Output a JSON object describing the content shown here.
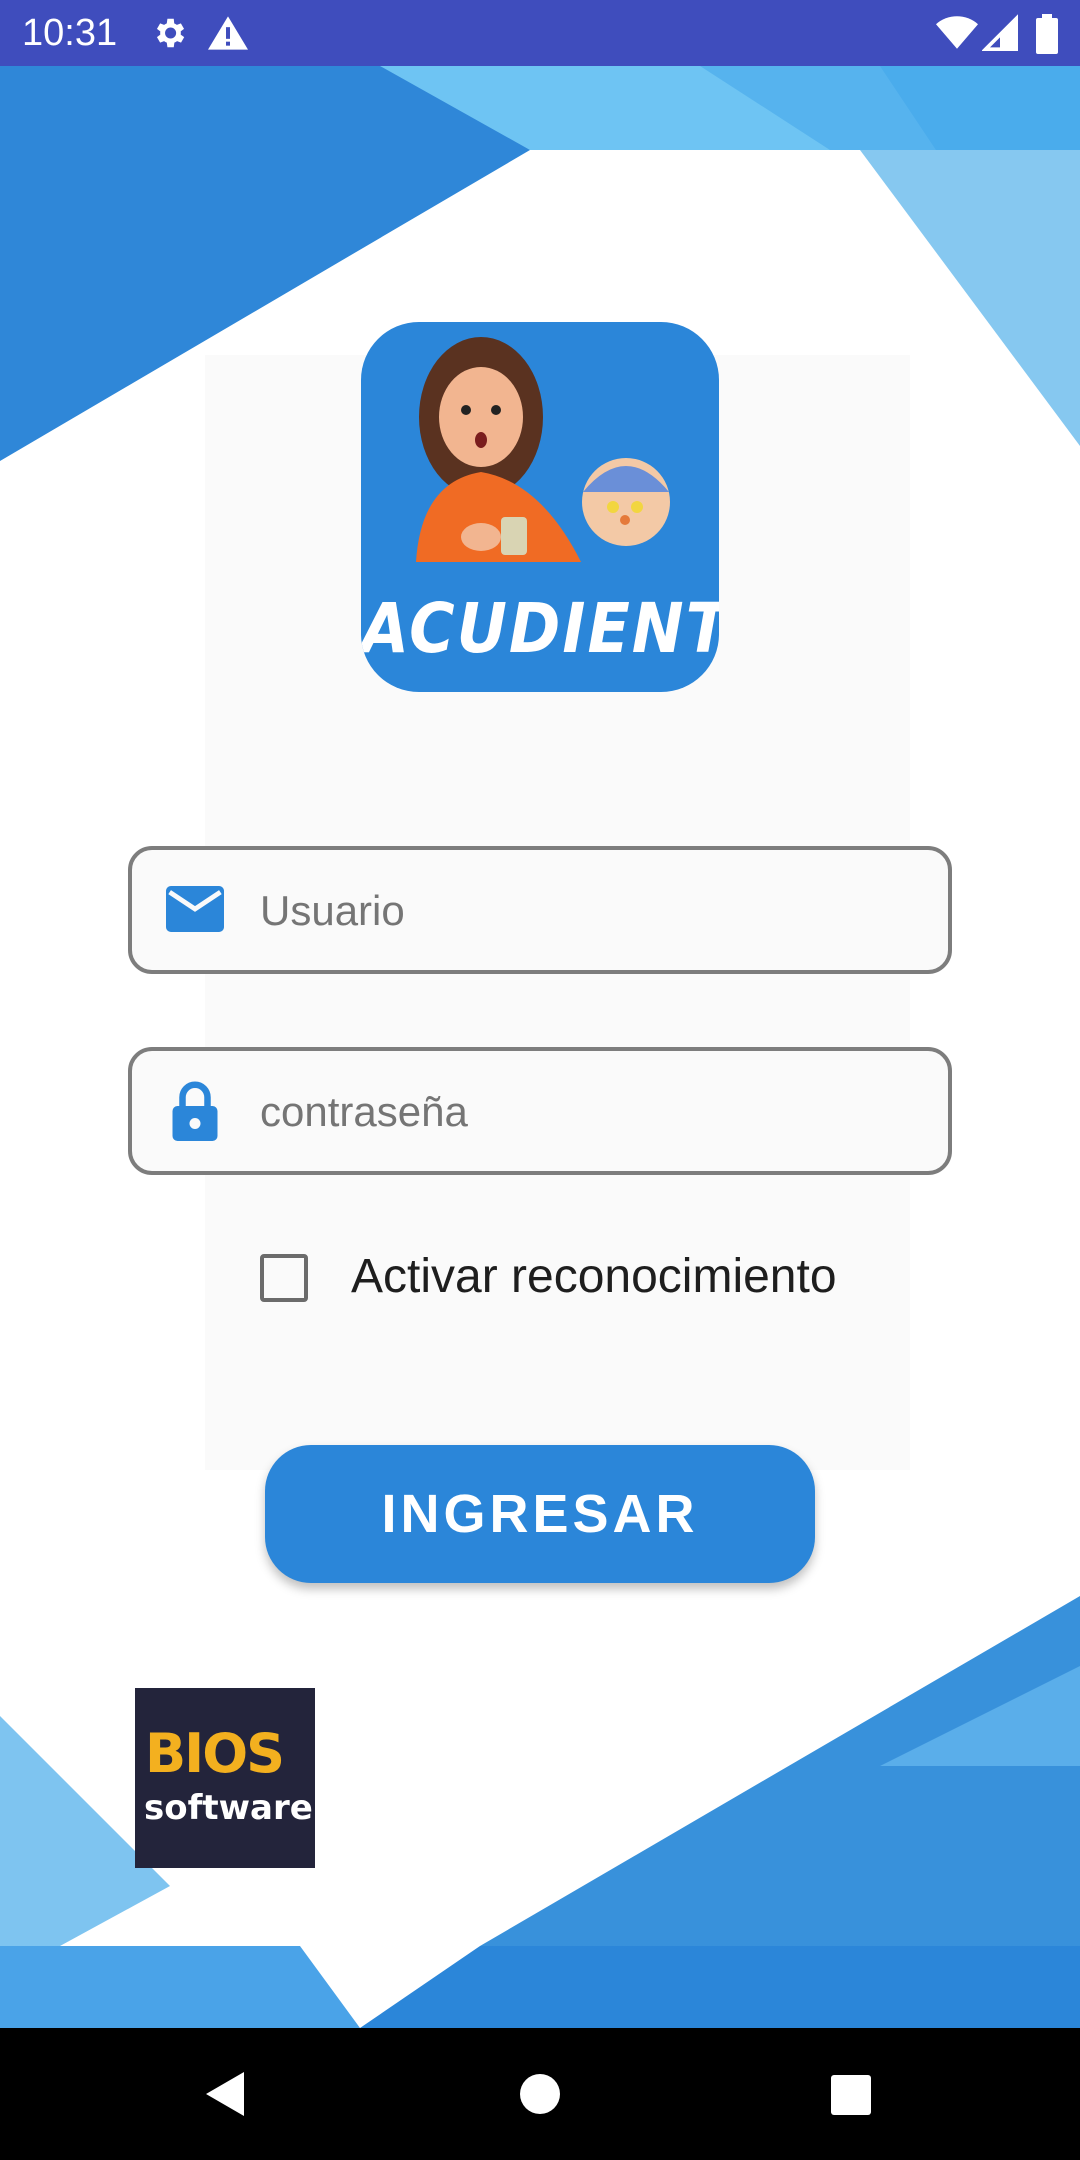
{
  "status_bar": {
    "time": "10:31",
    "icons": [
      "gear-icon",
      "warning-icon",
      "wifi-icon",
      "signal-icon",
      "battery-icon"
    ]
  },
  "app_logo": {
    "text": "ACUDIENTE"
  },
  "login": {
    "username_placeholder": "Usuario",
    "password_placeholder": "contraseña",
    "checkbox_label": "Activar reconocimiento",
    "checkbox_checked": false,
    "submit_label": "INGRESAR"
  },
  "footer_logo": {
    "main": "BIOS",
    "sub": "software"
  },
  "nav_bar": {
    "items": [
      "back-icon",
      "home-icon",
      "recents-icon"
    ]
  },
  "colors": {
    "status_bar": "#3f4dbd",
    "accent": "#2b86d9",
    "bios_yellow": "#f3b01f"
  }
}
